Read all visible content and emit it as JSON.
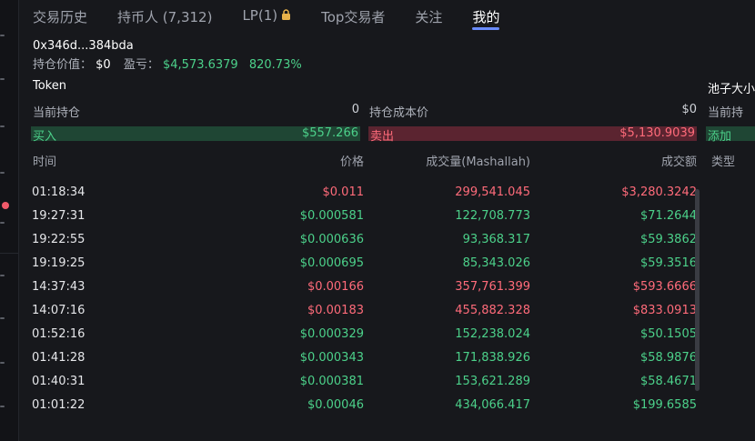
{
  "tabs": [
    "交易历史",
    "持币人 (7,312)",
    "LP(1)",
    "Top交易者",
    "关注",
    "我的"
  ],
  "active_tab": "我的",
  "wallet": {
    "address": "0x346d...384bda",
    "holding_label": "持仓价值：",
    "holding_value": "$0",
    "pnl_label": "盈亏：",
    "pnl_value": "$4,573.6379",
    "pnl_pct": "820.73%"
  },
  "token_label": "Token",
  "pool_label": "池子大小",
  "position": {
    "current_label": "当前持仓",
    "current_value": "0",
    "cost_label": "持仓成本价",
    "cost_value": "$0",
    "current_label_2": "当前持"
  },
  "bars": {
    "buy_label": "买入",
    "buy_value": "$557.266",
    "sell_label": "卖出",
    "sell_value": "$5,130.9039",
    "add_label": "添加"
  },
  "table": {
    "headers": {
      "time": "时间",
      "price": "价格",
      "volume": "成交量(Mashallah)",
      "amount": "成交额",
      "type": "类型"
    },
    "rows": [
      {
        "time": "01:18:34",
        "price": "$0.011",
        "volume": "299,541.045",
        "amount": "$3,280.3242",
        "side": "sell"
      },
      {
        "time": "19:27:31",
        "price": "$0.000581",
        "volume": "122,708.773",
        "amount": "$71.2644",
        "side": "buy"
      },
      {
        "time": "19:22:55",
        "price": "$0.000636",
        "volume": "93,368.317",
        "amount": "$59.3862",
        "side": "buy"
      },
      {
        "time": "19:19:25",
        "price": "$0.000695",
        "volume": "85,343.026",
        "amount": "$59.3516",
        "side": "buy"
      },
      {
        "time": "14:37:43",
        "price": "$0.00166",
        "volume": "357,761.399",
        "amount": "$593.6666",
        "side": "sell"
      },
      {
        "time": "14:07:16",
        "price": "$0.00183",
        "volume": "455,882.328",
        "amount": "$833.0913",
        "side": "sell"
      },
      {
        "time": "01:52:16",
        "price": "$0.000329",
        "volume": "152,238.024",
        "amount": "$50.1505",
        "side": "buy"
      },
      {
        "time": "01:41:28",
        "price": "$0.000343",
        "volume": "171,838.926",
        "amount": "$58.9876",
        "side": "buy"
      },
      {
        "time": "01:40:31",
        "price": "$0.000381",
        "volume": "153,621.289",
        "amount": "$58.4671",
        "side": "buy"
      },
      {
        "time": "01:01:22",
        "price": "$0.00046",
        "volume": "434,066.417",
        "amount": "$199.6585",
        "side": "buy"
      }
    ]
  },
  "colors": {
    "buy": "#4cd18a",
    "sell": "#ff6b7a",
    "accent": "#6a8cff",
    "lock": "#e8b24a"
  },
  "icons": [
    "lock-icon"
  ]
}
